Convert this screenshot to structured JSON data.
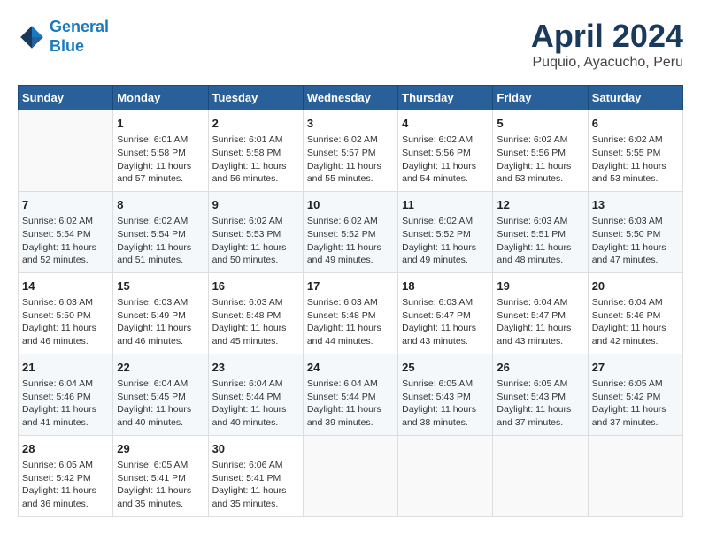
{
  "logo": {
    "line1": "General",
    "line2": "Blue"
  },
  "title": "April 2024",
  "subtitle": "Puquio, Ayacucho, Peru",
  "headers": [
    "Sunday",
    "Monday",
    "Tuesday",
    "Wednesday",
    "Thursday",
    "Friday",
    "Saturday"
  ],
  "weeks": [
    [
      {
        "day": "",
        "info": ""
      },
      {
        "day": "1",
        "info": "Sunrise: 6:01 AM\nSunset: 5:58 PM\nDaylight: 11 hours\nand 57 minutes."
      },
      {
        "day": "2",
        "info": "Sunrise: 6:01 AM\nSunset: 5:58 PM\nDaylight: 11 hours\nand 56 minutes."
      },
      {
        "day": "3",
        "info": "Sunrise: 6:02 AM\nSunset: 5:57 PM\nDaylight: 11 hours\nand 55 minutes."
      },
      {
        "day": "4",
        "info": "Sunrise: 6:02 AM\nSunset: 5:56 PM\nDaylight: 11 hours\nand 54 minutes."
      },
      {
        "day": "5",
        "info": "Sunrise: 6:02 AM\nSunset: 5:56 PM\nDaylight: 11 hours\nand 53 minutes."
      },
      {
        "day": "6",
        "info": "Sunrise: 6:02 AM\nSunset: 5:55 PM\nDaylight: 11 hours\nand 53 minutes."
      }
    ],
    [
      {
        "day": "7",
        "info": "Sunrise: 6:02 AM\nSunset: 5:54 PM\nDaylight: 11 hours\nand 52 minutes."
      },
      {
        "day": "8",
        "info": "Sunrise: 6:02 AM\nSunset: 5:54 PM\nDaylight: 11 hours\nand 51 minutes."
      },
      {
        "day": "9",
        "info": "Sunrise: 6:02 AM\nSunset: 5:53 PM\nDaylight: 11 hours\nand 50 minutes."
      },
      {
        "day": "10",
        "info": "Sunrise: 6:02 AM\nSunset: 5:52 PM\nDaylight: 11 hours\nand 49 minutes."
      },
      {
        "day": "11",
        "info": "Sunrise: 6:02 AM\nSunset: 5:52 PM\nDaylight: 11 hours\nand 49 minutes."
      },
      {
        "day": "12",
        "info": "Sunrise: 6:03 AM\nSunset: 5:51 PM\nDaylight: 11 hours\nand 48 minutes."
      },
      {
        "day": "13",
        "info": "Sunrise: 6:03 AM\nSunset: 5:50 PM\nDaylight: 11 hours\nand 47 minutes."
      }
    ],
    [
      {
        "day": "14",
        "info": "Sunrise: 6:03 AM\nSunset: 5:50 PM\nDaylight: 11 hours\nand 46 minutes."
      },
      {
        "day": "15",
        "info": "Sunrise: 6:03 AM\nSunset: 5:49 PM\nDaylight: 11 hours\nand 46 minutes."
      },
      {
        "day": "16",
        "info": "Sunrise: 6:03 AM\nSunset: 5:48 PM\nDaylight: 11 hours\nand 45 minutes."
      },
      {
        "day": "17",
        "info": "Sunrise: 6:03 AM\nSunset: 5:48 PM\nDaylight: 11 hours\nand 44 minutes."
      },
      {
        "day": "18",
        "info": "Sunrise: 6:03 AM\nSunset: 5:47 PM\nDaylight: 11 hours\nand 43 minutes."
      },
      {
        "day": "19",
        "info": "Sunrise: 6:04 AM\nSunset: 5:47 PM\nDaylight: 11 hours\nand 43 minutes."
      },
      {
        "day": "20",
        "info": "Sunrise: 6:04 AM\nSunset: 5:46 PM\nDaylight: 11 hours\nand 42 minutes."
      }
    ],
    [
      {
        "day": "21",
        "info": "Sunrise: 6:04 AM\nSunset: 5:46 PM\nDaylight: 11 hours\nand 41 minutes."
      },
      {
        "day": "22",
        "info": "Sunrise: 6:04 AM\nSunset: 5:45 PM\nDaylight: 11 hours\nand 40 minutes."
      },
      {
        "day": "23",
        "info": "Sunrise: 6:04 AM\nSunset: 5:44 PM\nDaylight: 11 hours\nand 40 minutes."
      },
      {
        "day": "24",
        "info": "Sunrise: 6:04 AM\nSunset: 5:44 PM\nDaylight: 11 hours\nand 39 minutes."
      },
      {
        "day": "25",
        "info": "Sunrise: 6:05 AM\nSunset: 5:43 PM\nDaylight: 11 hours\nand 38 minutes."
      },
      {
        "day": "26",
        "info": "Sunrise: 6:05 AM\nSunset: 5:43 PM\nDaylight: 11 hours\nand 37 minutes."
      },
      {
        "day": "27",
        "info": "Sunrise: 6:05 AM\nSunset: 5:42 PM\nDaylight: 11 hours\nand 37 minutes."
      }
    ],
    [
      {
        "day": "28",
        "info": "Sunrise: 6:05 AM\nSunset: 5:42 PM\nDaylight: 11 hours\nand 36 minutes."
      },
      {
        "day": "29",
        "info": "Sunrise: 6:05 AM\nSunset: 5:41 PM\nDaylight: 11 hours\nand 35 minutes."
      },
      {
        "day": "30",
        "info": "Sunrise: 6:06 AM\nSunset: 5:41 PM\nDaylight: 11 hours\nand 35 minutes."
      },
      {
        "day": "",
        "info": ""
      },
      {
        "day": "",
        "info": ""
      },
      {
        "day": "",
        "info": ""
      },
      {
        "day": "",
        "info": ""
      }
    ]
  ]
}
